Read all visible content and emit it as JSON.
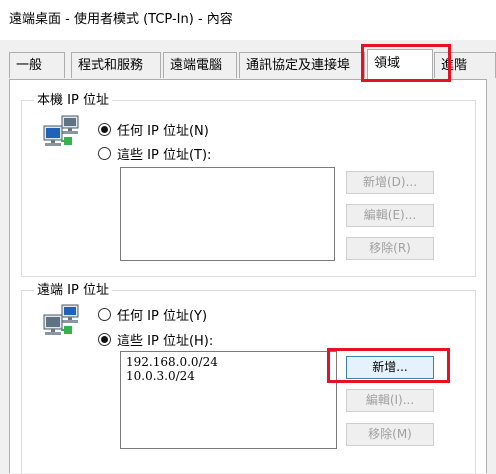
{
  "window": {
    "title": "遠端桌面 - 使用者模式 (TCP-In) - 內容"
  },
  "tabs": [
    {
      "label": "一般"
    },
    {
      "label": "程式和服務"
    },
    {
      "label": "遠端電腦"
    },
    {
      "label": "通訊協定及連接埠"
    },
    {
      "label": "領域"
    },
    {
      "label": "進階"
    }
  ],
  "local_ip": {
    "group_title": "本機 IP 位址",
    "any_label": "任何 IP 位址(N)",
    "these_label": "這些 IP 位址(T):",
    "selected": "any",
    "addresses": [],
    "add_label": "新增(D)...",
    "edit_label": "編輯(E)...",
    "remove_label": "移除(R)"
  },
  "remote_ip": {
    "group_title": "遠端 IP 位址",
    "any_label": "任何 IP 位址(Y)",
    "these_label": "這些 IP 位址(H):",
    "selected": "these",
    "addresses": [
      "192.168.0.0/24",
      "10.0.3.0/24"
    ],
    "add_label": "新增...",
    "edit_label": "編輯(I)...",
    "remove_label": "移除(M)"
  },
  "colors": {
    "highlight": "#e81123",
    "tab_border": "#adadad"
  },
  "icons": {
    "network": "network-computers-icon"
  }
}
